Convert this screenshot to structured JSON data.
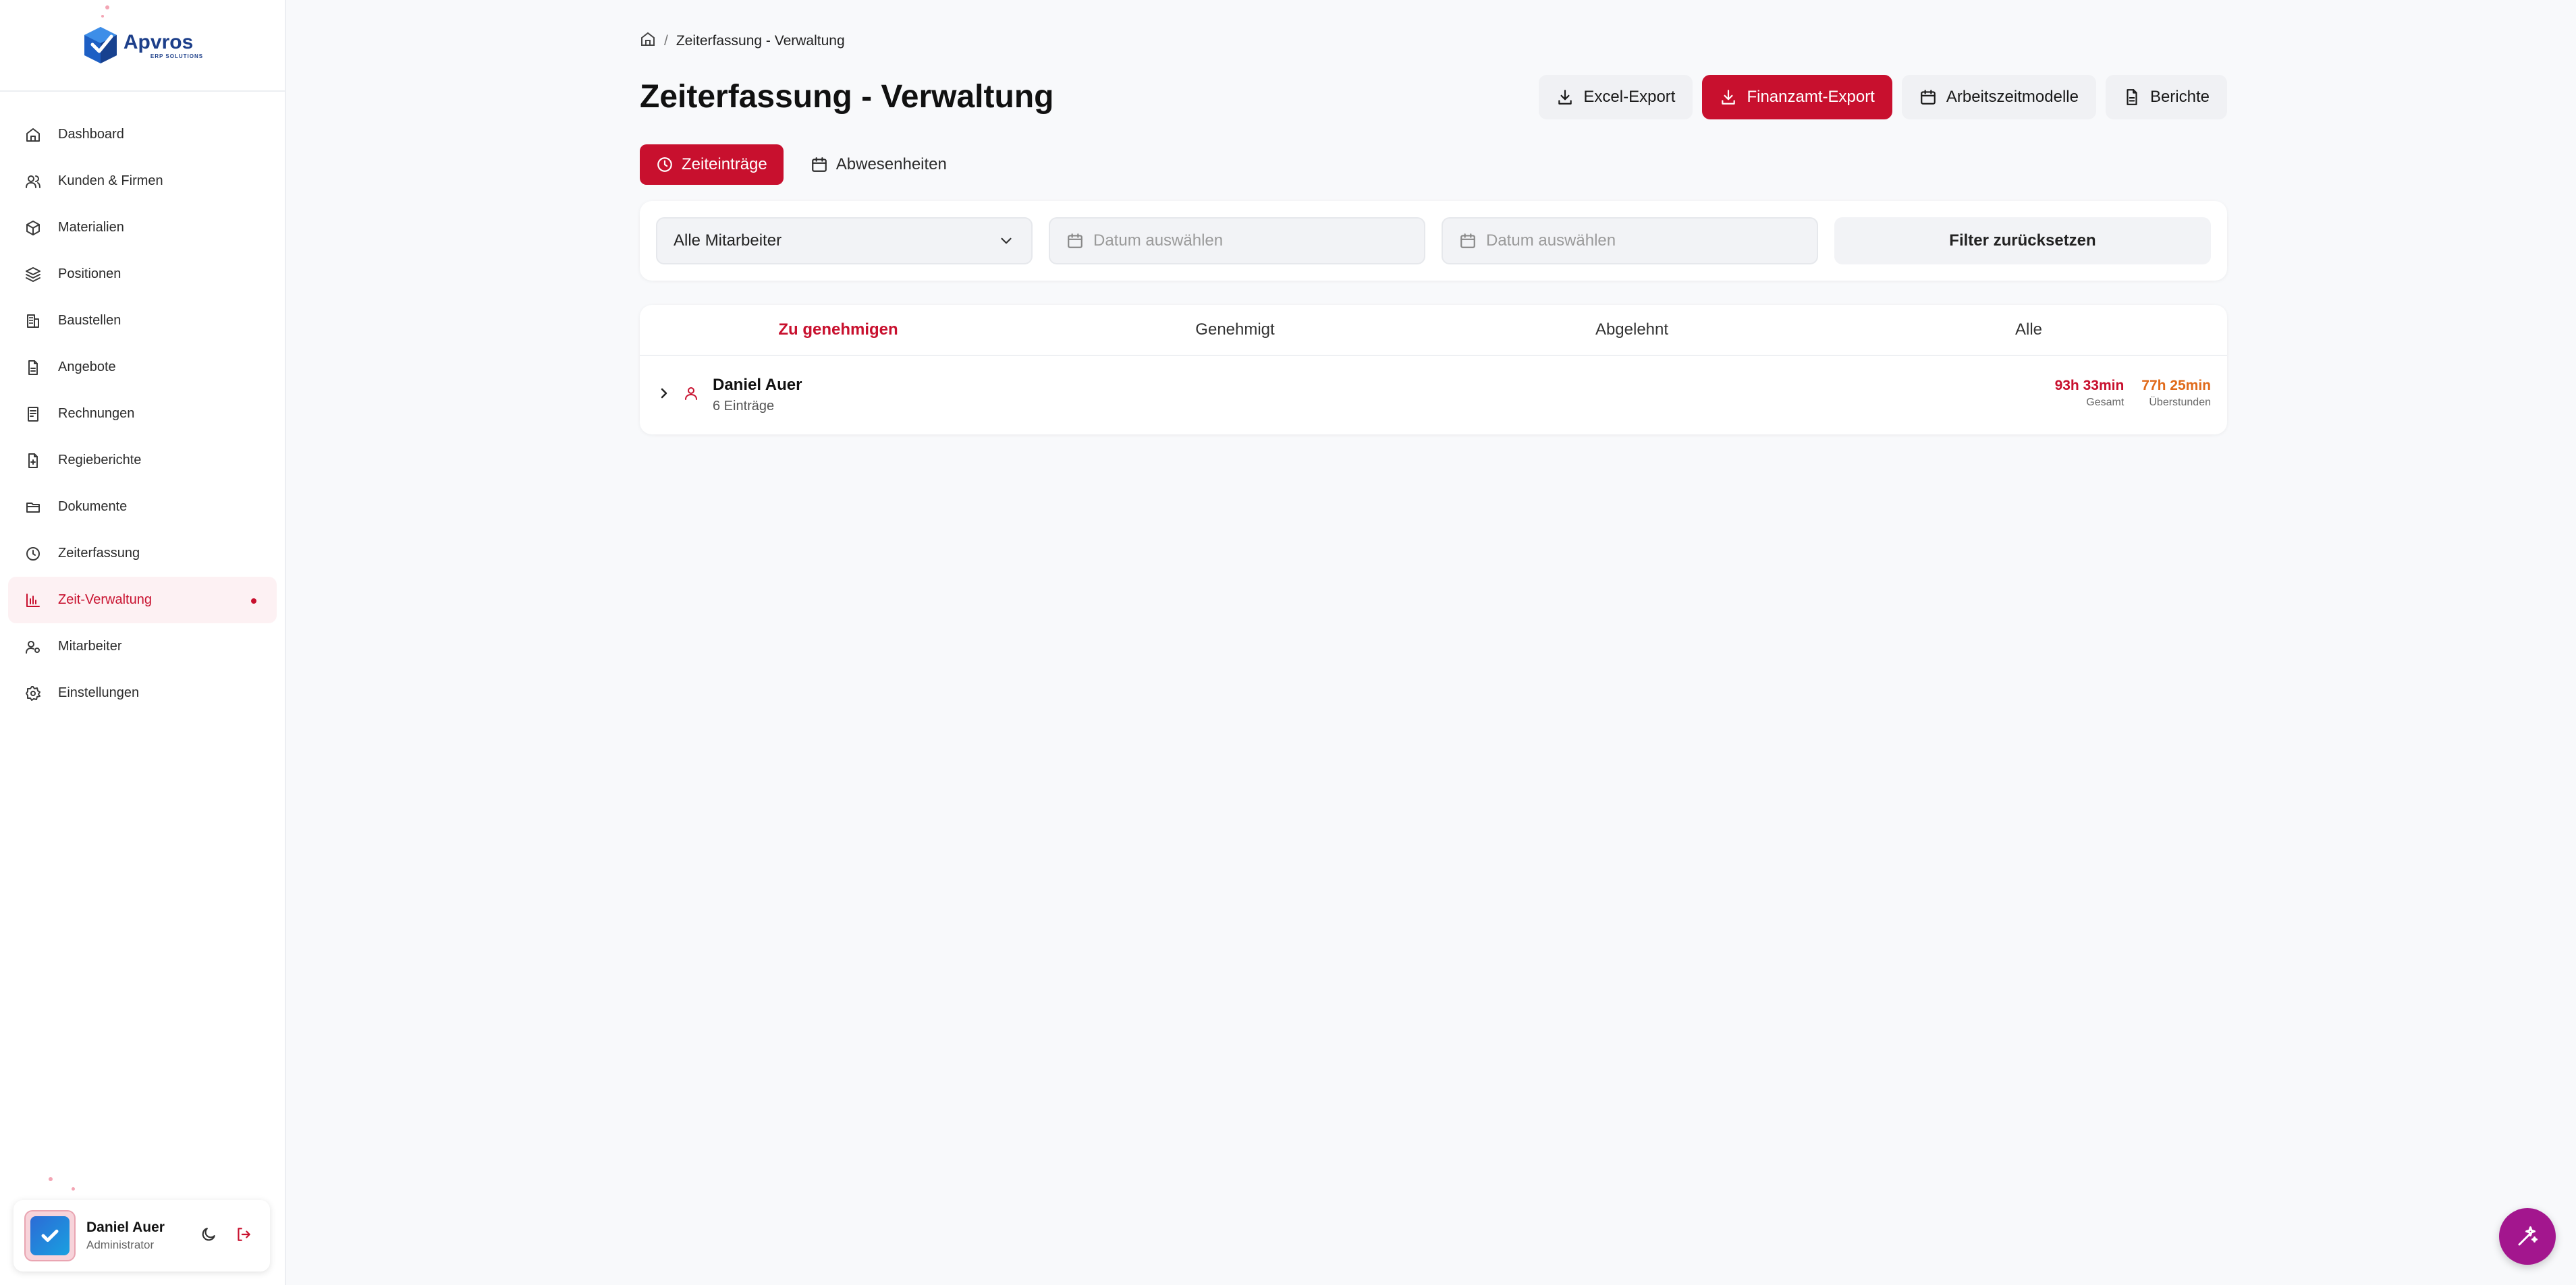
{
  "app": {
    "logo_name": "Apvros",
    "logo_sub": "ERP SOLUTIONS"
  },
  "sidebar": {
    "items": [
      {
        "label": "Dashboard",
        "icon": "home-icon"
      },
      {
        "label": "Kunden & Firmen",
        "icon": "users-icon"
      },
      {
        "label": "Materialien",
        "icon": "package-icon"
      },
      {
        "label": "Positionen",
        "icon": "layers-icon"
      },
      {
        "label": "Baustellen",
        "icon": "building-icon"
      },
      {
        "label": "Angebote",
        "icon": "file-icon"
      },
      {
        "label": "Rechnungen",
        "icon": "receipt-icon"
      },
      {
        "label": "Regieberichte",
        "icon": "file-report-icon"
      },
      {
        "label": "Dokumente",
        "icon": "folder-icon"
      },
      {
        "label": "Zeiterfassung",
        "icon": "clock-icon"
      },
      {
        "label": "Zeit-Verwaltung",
        "icon": "chart-bars-icon",
        "active": true
      },
      {
        "label": "Mitarbeiter",
        "icon": "user-cog-icon"
      },
      {
        "label": "Einstellungen",
        "icon": "gear-icon"
      }
    ]
  },
  "user": {
    "name": "Daniel Auer",
    "role": "Administrator"
  },
  "breadcrumb": {
    "current": "Zeiterfassung - Verwaltung"
  },
  "page": {
    "title": "Zeiterfassung - Verwaltung"
  },
  "toolbar": {
    "excel_label": "Excel-Export",
    "finanzamt_label": "Finanzamt-Export",
    "arbeitszeit_label": "Arbeitszeitmodelle",
    "berichte_label": "Berichte"
  },
  "tabs": {
    "entries_label": "Zeiteinträge",
    "absences_label": "Abwesenheiten"
  },
  "filters": {
    "employee_value": "Alle Mitarbeiter",
    "date_from_placeholder": "Datum auswählen",
    "date_to_placeholder": "Datum auswählen",
    "reset_label": "Filter zurücksetzen"
  },
  "status_tabs": {
    "pending": "Zu genehmigen",
    "approved": "Genehmigt",
    "rejected": "Abgelehnt",
    "all": "Alle"
  },
  "employees": [
    {
      "name": "Daniel Auer",
      "count": "6 Einträge",
      "total_value": "93h 33min",
      "total_label": "Gesamt",
      "overtime_value": "77h 25min",
      "overtime_label": "Überstunden"
    }
  ],
  "colors": {
    "accent": "#c8102e",
    "overtime": "#e06a1a",
    "fab": "#a3168e"
  }
}
